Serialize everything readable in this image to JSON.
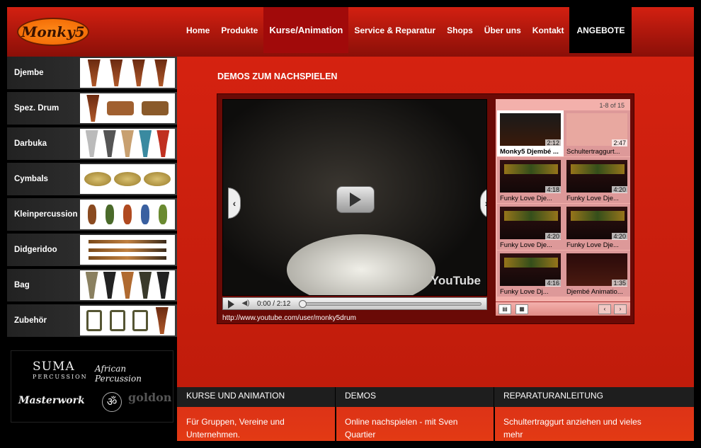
{
  "logo": {
    "text": "Monky5"
  },
  "nav": {
    "items": [
      "Home",
      "Produkte",
      "Kurse/Animation",
      "Service & Reparatur",
      "Shops",
      "Über uns",
      "Kontakt",
      "ANGEBOTE"
    ],
    "active": "Kurse/Animation"
  },
  "sidebar": {
    "categories": [
      "Djembe",
      "Spez. Drum",
      "Darbuka",
      "Cymbals",
      "Kleinpercussion",
      "Didgeridoo",
      "Bag",
      "Zubehör"
    ]
  },
  "brands": {
    "suma": "SUMA",
    "suma_sub": "PERCUSSION",
    "african": "African Percussion",
    "masterwork": "Masterwork",
    "goldon": "goldon"
  },
  "main": {
    "title": "DEMOS ZUM NACHSPIELEN"
  },
  "player": {
    "logo": "YouTube",
    "time": "0:00 / 2:12",
    "url": "http://www.youtube.com/user/monky5drum",
    "progress": 0,
    "playlist_count": "1-8 of 15",
    "videos": [
      {
        "title": "Monky5 Djembé ...",
        "duration": "2:12"
      },
      {
        "title": "Schultertraggurt...",
        "duration": "2:47"
      },
      {
        "title": "Funky Love Dje...",
        "duration": "4:18"
      },
      {
        "title": "Funky Love Dje...",
        "duration": "4:20"
      },
      {
        "title": "Funky Love Dje...",
        "duration": "4:20"
      },
      {
        "title": "Funky Love Dje...",
        "duration": "4:20"
      },
      {
        "title": "Funky Love Dj...",
        "duration": "4:16"
      },
      {
        "title": "Djembé Animatio...",
        "duration": "1:35"
      }
    ]
  },
  "footer": {
    "cols": [
      {
        "head": "KURSE UND ANIMATION",
        "body": "Für Gruppen, Vereine und Unternehmen."
      },
      {
        "head": "DEMOS",
        "body": "Online nachspielen - mit Sven Quartier"
      },
      {
        "head": "REPARATURANLEITUNG",
        "body": "Schultertraggurt anziehen und vieles mehr"
      }
    ]
  },
  "colors": {
    "accent": "#d52210",
    "dark": "#1e1e1e"
  }
}
